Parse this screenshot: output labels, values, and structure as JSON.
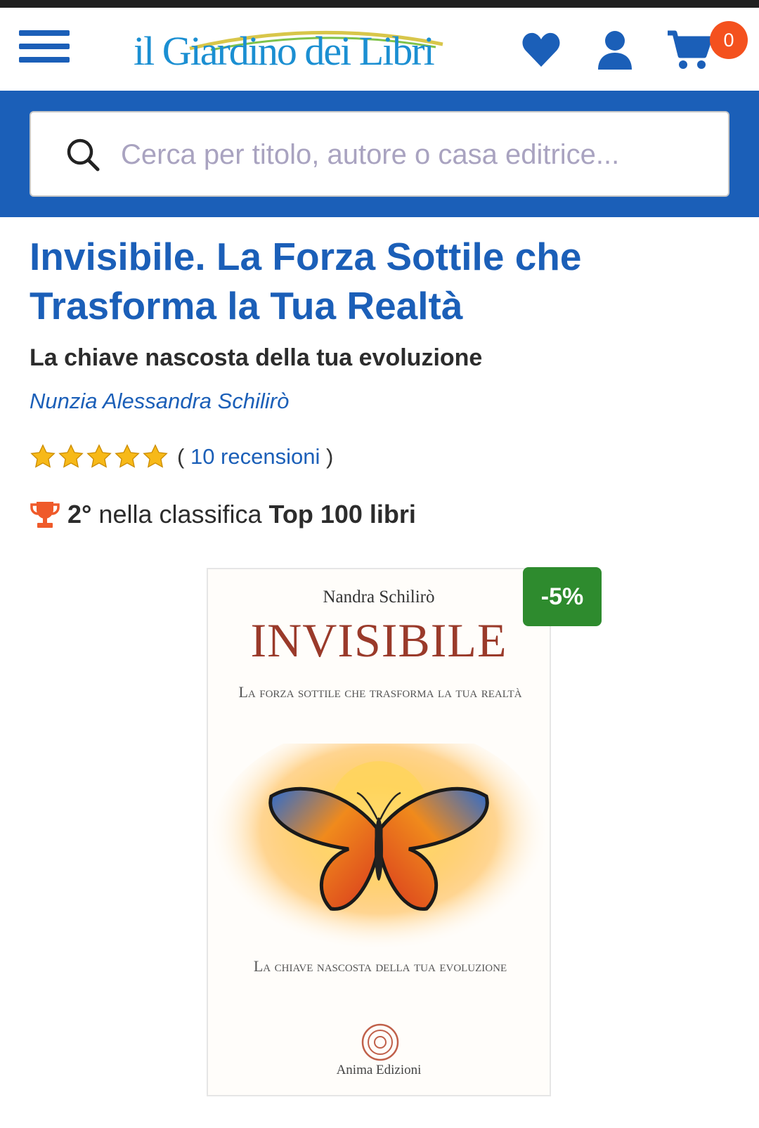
{
  "header": {
    "logo_text": "il Giardino dei Libri",
    "cart_count": "0",
    "icons": [
      "menu-icon",
      "heart-icon",
      "user-icon",
      "cart-icon"
    ],
    "brand_color": "#1b5fb8"
  },
  "search": {
    "placeholder": "Cerca per titolo, autore o casa editrice..."
  },
  "product": {
    "title": "Invisibile. La Forza Sottile che Trasforma la Tua Realtà",
    "subtitle": "La chiave nascosta della tua evoluzione",
    "author": "Nunzia Alessandra Schilirò",
    "rating": {
      "stars": 5,
      "open": "(",
      "reviews_label": "10 recensioni",
      "close": ")"
    },
    "ranking": {
      "position": "2°",
      "text": "nella classifica",
      "list": "Top 100 libri"
    },
    "discount": "-5%",
    "cover": {
      "author": "Nandra Schilirò",
      "title": "INVISIBILE",
      "subtitle": "La forza sottile che trasforma la tua realtà",
      "tagline": "La chiave nascosta della tua evoluzione",
      "publisher": "Anima Edizioni"
    }
  }
}
